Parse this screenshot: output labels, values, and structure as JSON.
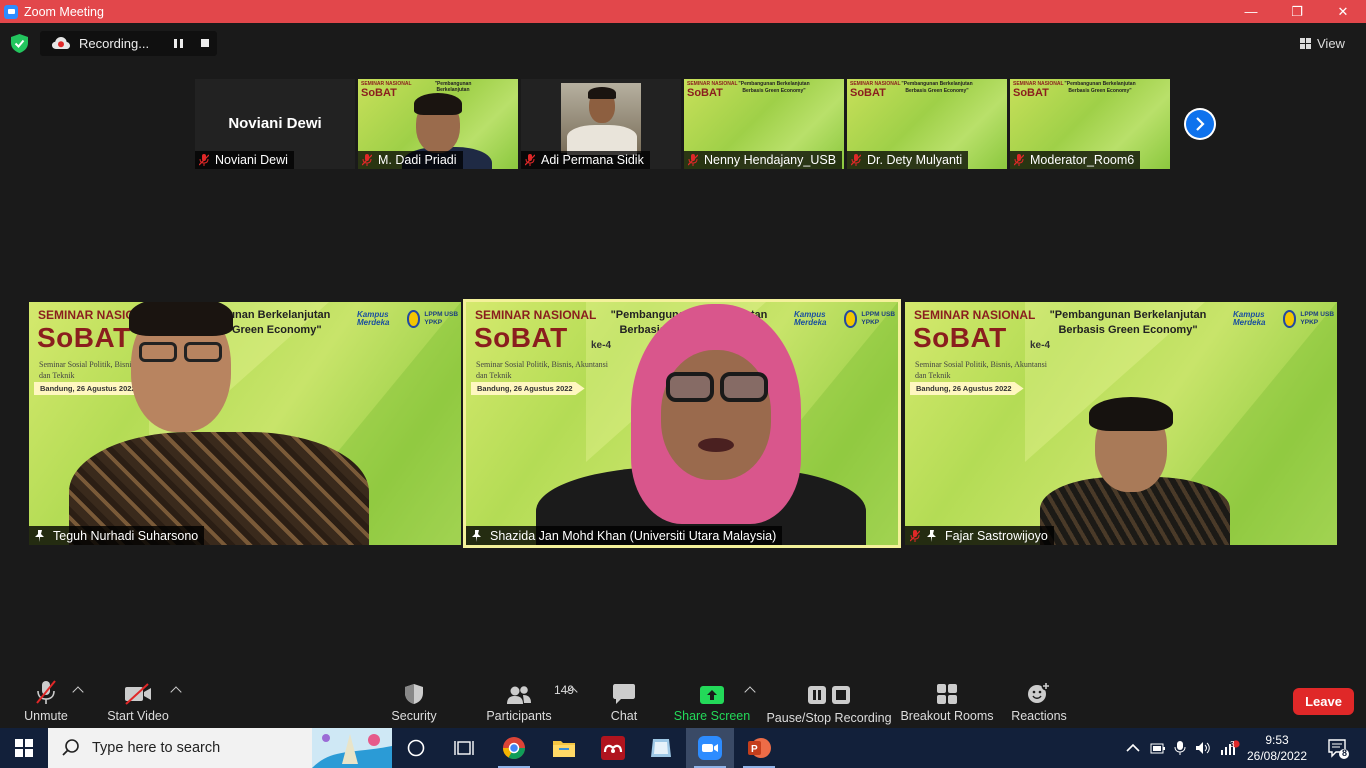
{
  "window": {
    "title": "Zoom Meeting",
    "min": "—",
    "restore": "❐",
    "close": "✕"
  },
  "recording": {
    "label": "Recording..."
  },
  "view": {
    "label": "View"
  },
  "thumbnails": [
    {
      "name": "Noviani Dewi",
      "big_name": "Noviani Dewi"
    },
    {
      "name": "M. Dadi Priadi"
    },
    {
      "name": "Adi Permana Sidik"
    },
    {
      "name": "Nenny Hendajany_USB"
    },
    {
      "name": "Dr. Dety Mulyanti"
    },
    {
      "name": "Moderator_Room6"
    }
  ],
  "slide": {
    "seminar": "SEMINAR NASIONAL",
    "sobat": "SoBAT",
    "ke": "ke-4",
    "theme_line1": "\"Pembangunan Berkelanjutan",
    "theme_line2": "Berbasis Green Economy\"",
    "subtitle": "Seminar Sosial Politik, Bisnis, Akuntansi dan Teknik",
    "date": "Bandung, 26 Agustus 2022",
    "logo_km": "Kampus Merdeka",
    "logo_lppm": "LPPM USB YPKP"
  },
  "videos": [
    {
      "name": "Teguh Nurhadi Suharsono"
    },
    {
      "name": "Shazida Jan Mohd Khan (Universiti Utara Malaysia)"
    },
    {
      "name": "Fajar Sastrowijoyo"
    }
  ],
  "toolbar": {
    "unmute": "Unmute",
    "start_video": "Start Video",
    "security": "Security",
    "participants": "Participants",
    "participant_count": "149",
    "chat": "Chat",
    "share_screen": "Share Screen",
    "pause_stop": "Pause/Stop Recording",
    "breakout": "Breakout Rooms",
    "reactions": "Reactions",
    "leave": "Leave"
  },
  "taskbar": {
    "search_placeholder": "Type here to search",
    "time": "9:53",
    "date": "26/08/2022",
    "notif_count": "8",
    "network_badge": "3"
  },
  "colors": {
    "title_bar": "#e2474b",
    "share_green": "#23d959",
    "leave_red": "#e02828",
    "active_outline": "#f3f19a"
  }
}
